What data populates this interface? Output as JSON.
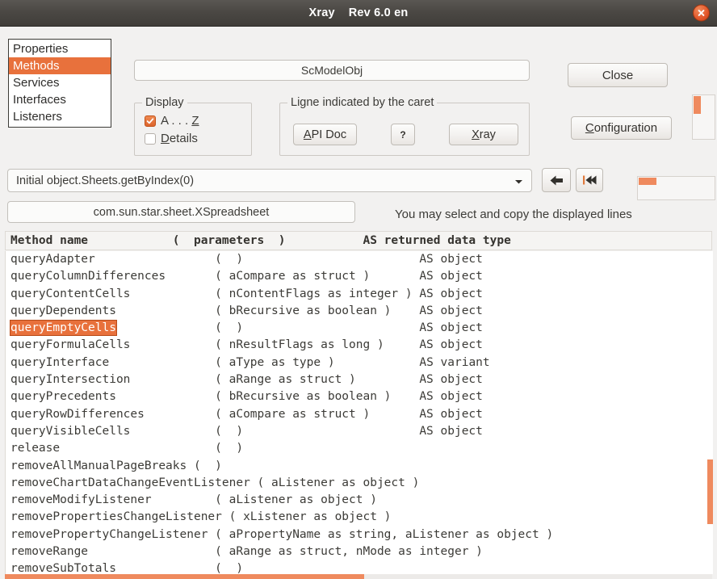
{
  "titlebar": {
    "title": "Xray    Rev 6.0 en",
    "close_icon": "close-icon"
  },
  "categories": {
    "items": [
      {
        "label": "Properties",
        "selected": false
      },
      {
        "label": "Methods",
        "selected": true
      },
      {
        "label": "Services",
        "selected": false
      },
      {
        "label": "Interfaces",
        "selected": false
      },
      {
        "label": "Listeners",
        "selected": false
      }
    ]
  },
  "object_name": "ScModelObj",
  "display_group": {
    "title": "Display",
    "options": [
      {
        "label": "A . . . Z",
        "mnemonic": "Z",
        "checked": true
      },
      {
        "label": "Details",
        "mnemonic": "D",
        "checked": false
      }
    ]
  },
  "caret_group": {
    "title": "Ligne indicated by the caret",
    "api_doc_label": "API Doc",
    "api_doc_mnemonic": "A",
    "help_label": "?",
    "xray_label": "Xray",
    "xray_mnemonic": "X"
  },
  "actions": {
    "close_label": "Close",
    "configuration_label": "Configuration",
    "configuration_mnemonic": "C",
    "back_icon": "back-arrow-icon",
    "first_icon": "skip-to-first-icon"
  },
  "path_combo": {
    "value": "Initial object.Sheets.getByIndex(0)",
    "chevron_icon": "chevron-down-icon"
  },
  "interface_name": "com.sun.star.sheet.XSpreadsheet",
  "hint": "You may select and copy the displayed lines",
  "table": {
    "header": "Method name            (  parameters  )           AS returned data type",
    "columns": [
      "Method name",
      "( parameters )",
      "AS returned data type"
    ],
    "rows": [
      {
        "pre": "queryAdapter                 (  )                         ",
        "sel": "",
        "post": "AS object"
      },
      {
        "pre": "queryColumnDifferences       ( aCompare as struct )       ",
        "sel": "",
        "post": "AS object"
      },
      {
        "pre": "queryContentCells            ( nContentFlags as integer ) ",
        "sel": "",
        "post": "AS object"
      },
      {
        "pre": "queryDependents              ( bRecursive as boolean )    ",
        "sel": "",
        "post": "AS object"
      },
      {
        "pre": "",
        "sel": "queryEmptyCells",
        "post": "              (  )                         AS object"
      },
      {
        "pre": "queryFormulaCells            ( nResultFlags as long )     ",
        "sel": "",
        "post": "AS object"
      },
      {
        "pre": "queryInterface               ( aType as type )           ",
        "sel": "",
        "post": " AS variant"
      },
      {
        "pre": "queryIntersection            ( aRange as struct )         ",
        "sel": "",
        "post": "AS object"
      },
      {
        "pre": "queryPrecedents              ( bRecursive as boolean )    ",
        "sel": "",
        "post": "AS object"
      },
      {
        "pre": "queryRowDifferences          ( aCompare as struct )       ",
        "sel": "",
        "post": "AS object"
      },
      {
        "pre": "queryVisibleCells            (  )                         ",
        "sel": "",
        "post": "AS object"
      },
      {
        "pre": "release                      (  )",
        "sel": "",
        "post": ""
      },
      {
        "pre": "removeAllManualPageBreaks (  )",
        "sel": "",
        "post": ""
      },
      {
        "pre": "removeChartDataChangeEventListener ( aListener as object )",
        "sel": "",
        "post": ""
      },
      {
        "pre": "removeModifyListener         ( aListener as object )",
        "sel": "",
        "post": ""
      },
      {
        "pre": "removePropertiesChangeListener ( xListener as object )",
        "sel": "",
        "post": ""
      },
      {
        "pre": "removePropertyChangeListener ( aPropertyName as string, aListener as object )",
        "sel": "",
        "post": ""
      },
      {
        "pre": "removeRange                  ( aRange as struct, nMode as integer )",
        "sel": "",
        "post": ""
      },
      {
        "pre": "removeSubTotals              (  )",
        "sel": "",
        "post": ""
      }
    ]
  },
  "colors": {
    "accent": "#e8713c",
    "scrollbar_thumb": "#ef8a5e",
    "titlebar": "#4a4743",
    "window_bg": "#f2f1f0"
  }
}
